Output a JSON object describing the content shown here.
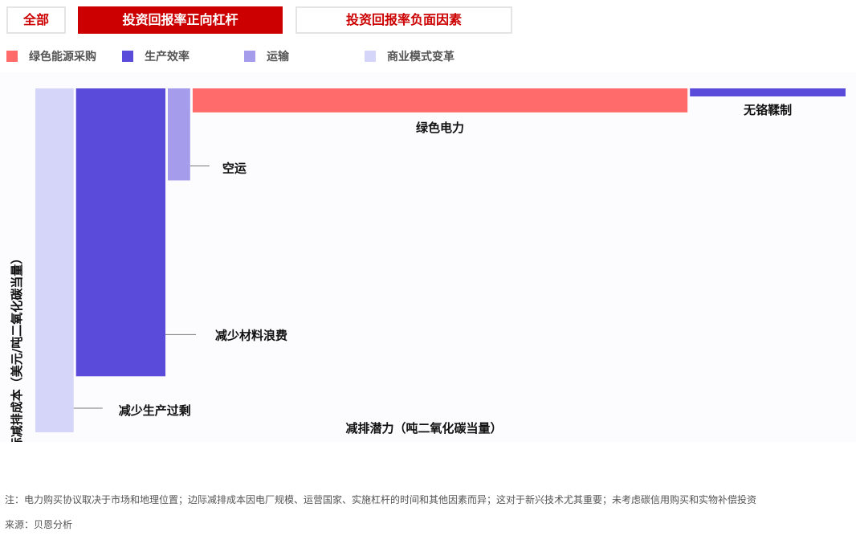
{
  "tabs": [
    {
      "label": "全部",
      "active": false
    },
    {
      "label": "投资回报率正向杠杆",
      "active": true
    },
    {
      "label": "投资回报率负面因素",
      "active": false
    }
  ],
  "legend": [
    {
      "label": "绿色能源采购",
      "color": "#ff6b6b"
    },
    {
      "label": "生产效率",
      "color": "#5b4bdb"
    },
    {
      "label": "运输",
      "color": "#a59cec"
    },
    {
      "label": "商业模式变革",
      "color": "#d5d5fa"
    }
  ],
  "chart_data": {
    "type": "bar",
    "subtype": "marginal-abatement-cost-curve",
    "xlabel": "减排潜力（吨二氧化碳当量）",
    "ylabel": "边际减排成本（美元/吨二氧化碳当量）",
    "bars": [
      {
        "label": "减少生产过剩",
        "category": "商业模式变革",
        "width": 4.8,
        "cost": -43
      },
      {
        "label": "减少材料浪费",
        "category": "生产效率",
        "width": 11.2,
        "cost": -36
      },
      {
        "label": "空运",
        "category": "运输",
        "width": 2.8,
        "cost": -11.5
      },
      {
        "label": "绿色电力",
        "category": "绿色能源采购",
        "width": 62,
        "cost": -3
      },
      {
        "label": "无铬鞣制",
        "category": "生产效率",
        "width": 19.5,
        "cost": -1
      }
    ]
  },
  "footnotes": {
    "note": "注：电力购买协议取决于市场和地理位置；边际减排成本因电厂规模、运营国家、实施杠杆的时间和其他因素而异；这对于新兴技术尤其重要；未考虑碳信用购买和实物补偿投资",
    "source": "来源：贝恩分析"
  }
}
